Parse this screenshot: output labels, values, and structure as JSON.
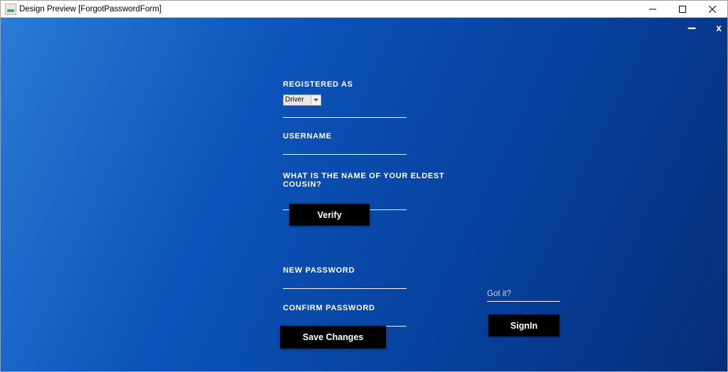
{
  "window": {
    "title": "Design Preview [ForgotPasswordForm]"
  },
  "inner": {
    "minimize": "–",
    "close": "x"
  },
  "form": {
    "registered_as_label": "REGISTERED AS",
    "registered_as_value": "Driver",
    "username_label": "USERNAME",
    "username_value": "",
    "security_question_label": "WHAT IS THE NAME OF YOUR ELDEST COUSIN?",
    "security_answer_value": "",
    "verify_label": "Verify",
    "new_password_label": "NEW PASSWORD",
    "new_password_value": "",
    "confirm_password_label": "CONFIRM PASSWORD",
    "confirm_password_value": "",
    "save_label": "Save Changes"
  },
  "aside": {
    "gotit_label": "Got it?",
    "signin_label": "SignIn"
  }
}
